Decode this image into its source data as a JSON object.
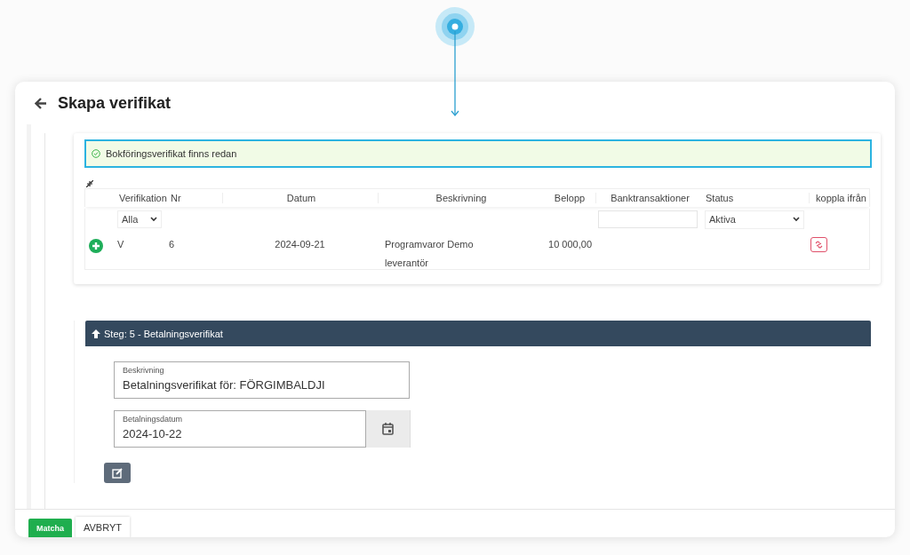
{
  "header": {
    "title": "Skapa verifikat"
  },
  "alert": {
    "text": "Bokföringsverifikat finns redan"
  },
  "table": {
    "columns": [
      "Verifikation",
      "Nr",
      "Datum",
      "Beskrivning",
      "Belopp",
      "Banktransaktioner",
      "Status",
      "koppla ifrån"
    ],
    "filters": {
      "verifikation": "Alla",
      "status": "Aktiva"
    },
    "rows": [
      {
        "verifikation": "V",
        "nr": "6",
        "datum": "2024-09-21",
        "beskrivning": "Programvaror Demo leverantör",
        "belopp": "10 000,00"
      }
    ]
  },
  "step": {
    "title": "Steg: 5 - Betalningsverifikat",
    "expanded": true,
    "fields": [
      {
        "kind": "text",
        "label": "Beskrivning",
        "value": "Betalningsverifikat för: FÖRGIMBALDJI"
      },
      {
        "kind": "date",
        "label": "Betalningsdatum",
        "value": "2024-10-22"
      }
    ]
  },
  "footer": {
    "buttons": [
      {
        "label": "Matcha",
        "kind": "primary"
      },
      {
        "label": "AVBRYT",
        "kind": "secondary"
      }
    ]
  }
}
